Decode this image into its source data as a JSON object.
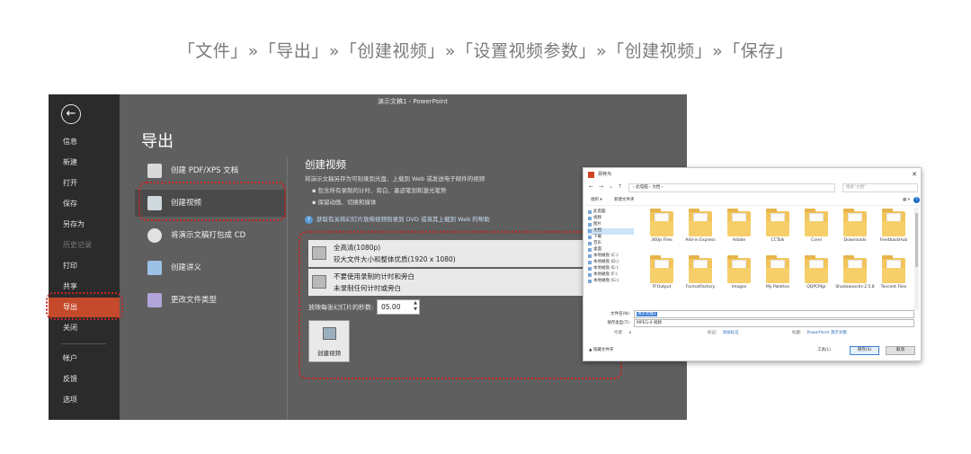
{
  "caption": "「文件」»「导出」»「创建视频」»「设置视频参数」»「创建视频」»「保存」",
  "ppt": {
    "window_title": "演示文稿1 - PowerPoint",
    "back_icon": "back-arrow-icon",
    "sidebar": [
      {
        "label": "信息"
      },
      {
        "label": "新建"
      },
      {
        "label": "打开"
      },
      {
        "label": "保存"
      },
      {
        "label": "另存为"
      },
      {
        "label": "历史记录"
      },
      {
        "label": "打印"
      },
      {
        "label": "共享"
      },
      {
        "label": "导出"
      },
      {
        "label": "关闭"
      },
      {
        "label": "帐户"
      },
      {
        "label": "反馈"
      },
      {
        "label": "选项"
      }
    ],
    "heading": "导出",
    "export_items": [
      {
        "label": "创建 PDF/XPS 文档"
      },
      {
        "label": "创建视频"
      },
      {
        "label": "将演示文稿打包成 CD"
      },
      {
        "label": "创建讲义"
      },
      {
        "label": "更改文件类型"
      }
    ],
    "video": {
      "title": "创建视频",
      "description": "将演示文稿另存为可刻录到光盘、上载到 Web 或发送电子邮件的视频",
      "bullets": [
        "包含所有录制的计时、旁白、墨迹笔划和激光笔势",
        "保留动画、切换和媒体"
      ],
      "help_link": "获取有关将幻灯片放映视频刻录到 DVD 或将其上载到 Web 的帮助",
      "quality_title": "全高清(1080p)",
      "quality_desc": "较大文件大小和整体优质(1920 x 1080)",
      "timing_title": "不要使用录制的计时和旁白",
      "timing_desc": "未录制任何计时或旁白",
      "seconds_label": "放映每张幻灯片的秒数:",
      "seconds_value": "05.00",
      "create_button": "创建视频"
    }
  },
  "dialog": {
    "title": "另存为",
    "address": "› 此电脑 › 文档 ›",
    "search_placeholder": "搜索\"文档\"",
    "organize": "组织 ▾",
    "new_folder": "新建文件夹",
    "tree": [
      "此电脑",
      "视频",
      "图片",
      "文档",
      "下载",
      "音乐",
      "桌面",
      "本地磁盘 (C:)",
      "本地磁盘 (D:)",
      "本地磁盘 (E:)",
      "本地磁盘 (F:)",
      "本地磁盘 (G:)"
    ],
    "files_row1": [
      "360js Files",
      "Add-in Express",
      "Adobe",
      "CCTalk",
      "Corel",
      "Downloads",
      "FeedbackHub"
    ],
    "files_row2": [
      "FFOutput",
      "FormatFactory",
      "Images",
      "My Palettes",
      "QQPCMgr",
      "Shadowsocks-2.5.8",
      "Tencent Files"
    ],
    "filename_label": "文件名(N):",
    "filename_value": "演示文稿1",
    "type_label": "保存类型(T):",
    "type_value": "MPEG-4 视频",
    "author_label": "作者:",
    "author_value": "x",
    "tags_label": "标记:",
    "tags_value": "添加标记",
    "title_label": "标题:",
    "title_value": "PowerPoint 演示文稿",
    "hide_folders": "▲ 隐藏文件夹",
    "tools": "工具(L)",
    "save_button": "保存(S)",
    "cancel_button": "取消"
  },
  "colors": {
    "ppt_bg": "#5f5f5f",
    "sidebar_bg": "#2b2b2b",
    "active": "#c54a2c",
    "highlight": "#c42424",
    "folder": "#f2c55c"
  }
}
